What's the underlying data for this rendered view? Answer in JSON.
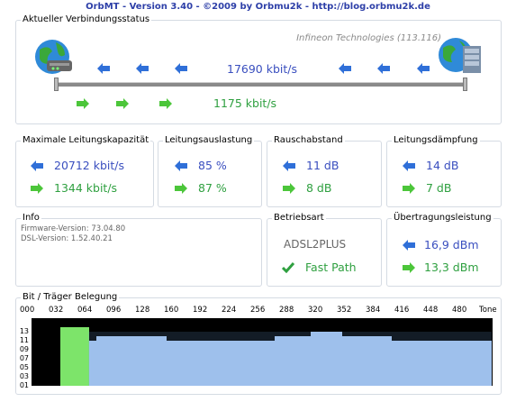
{
  "title": "OrbMT - Version 3.40 - ©2009 by Orbmu2k - http://blog.orbmu2k.de",
  "status": {
    "legend": "Aktueller Verbindungsstatus",
    "chipset": "Infineon Technologies (113.116)",
    "down_rate": "17690 kbit/s",
    "up_rate": "1175 kbit/s"
  },
  "capacity": {
    "legend": "Maximale Leitungskapazität",
    "down": "20712 kbit/s",
    "up": "1344 kbit/s"
  },
  "utilization": {
    "legend": "Leitungsauslastung",
    "down": "85 %",
    "up": "87 %"
  },
  "snr": {
    "legend": "Rauschabstand",
    "down": "11 dB",
    "up": "8 dB"
  },
  "attenuation": {
    "legend": "Leitungsdämpfung",
    "down": "14 dB",
    "up": "7 dB"
  },
  "info": {
    "legend": "Info",
    "firmware": "Firmware-Version: 73.04.80",
    "dsl": "DSL-Version: 1.52.40.21"
  },
  "mode": {
    "legend": "Betriebsart",
    "standard": "ADSL2PLUS",
    "path": "Fast Path"
  },
  "power": {
    "legend": "Übertragungsleistung",
    "down": "16,9 dBm",
    "up": "13,3 dBm"
  },
  "bits": {
    "legend": "Bit / Träger Belegung",
    "x_ticks": [
      "000",
      "032",
      "064",
      "096",
      "128",
      "160",
      "192",
      "224",
      "256",
      "288",
      "320",
      "352",
      "384",
      "416",
      "448",
      "480",
      "Tone"
    ],
    "y_ticks": [
      "13",
      "11",
      "09",
      "07",
      "05",
      "03",
      "01"
    ]
  },
  "colors": {
    "blue": "#3a4fbf",
    "green": "#2fa040",
    "bar_blue": "#a9c8f0",
    "bar_green": "#7de46a"
  },
  "chart_data": {
    "type": "bar",
    "title": "Bit / Träger Belegung",
    "x_range": [
      0,
      511
    ],
    "y_range": [
      0,
      15
    ],
    "upstream": {
      "tone_range": [
        32,
        63
      ],
      "bits": 13
    },
    "downstream_segments": [
      {
        "from": 64,
        "to": 72,
        "bits": 10
      },
      {
        "from": 72,
        "to": 150,
        "bits": 11
      },
      {
        "from": 150,
        "to": 200,
        "bits": 10
      },
      {
        "from": 200,
        "to": 270,
        "bits": 10
      },
      {
        "from": 270,
        "to": 310,
        "bits": 11
      },
      {
        "from": 310,
        "to": 345,
        "bits": 12
      },
      {
        "from": 345,
        "to": 400,
        "bits": 11
      },
      {
        "from": 400,
        "to": 511,
        "bits": 10
      }
    ]
  }
}
